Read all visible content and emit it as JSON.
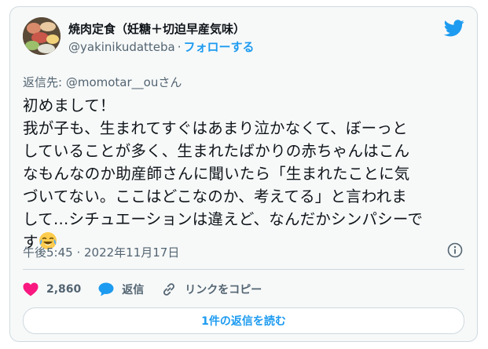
{
  "author": {
    "display_name": "焼肉定食（妊糖＋切迫早産気味）",
    "handle": "@yakinikudatteba",
    "separator": "·",
    "follow_label": "フォローする"
  },
  "reply_context": {
    "prefix": "返信先:",
    "mention": "@momotar__ouさん"
  },
  "tweet": {
    "lines": [
      "初めまして！",
      "我が子も、生まれてすぐはあまり泣かなくて、ぼーっと",
      "していることが多く、生まれたばかりの赤ちゃんはこん",
      "なもんなのか助産師さんに聞いたら「生まれたことに気",
      "づいてない。ここはどこなのか、考えてる」と言われま",
      "して…シチュエーションは違えど、なんだかシンパシーで",
      "す"
    ],
    "emoji": "face-with-tears-of-joy"
  },
  "meta": {
    "timestamp": "午後5:45 · 2022年11月17日"
  },
  "actions": {
    "like_count": "2,860",
    "reply_label": "返信",
    "copy_link_label": "リンクをコピー"
  },
  "footer": {
    "read_replies_label": "1件の返信を読む"
  },
  "icons": {
    "brand": "twitter-bird-icon",
    "info": "info-icon",
    "like": "heart-icon",
    "reply": "speech-bubble-icon",
    "copy": "link-icon"
  },
  "colors": {
    "accent": "#1d9bf0",
    "like": "#f91880",
    "text": "#0f1419",
    "muted": "#536471",
    "border": "#cfd9de",
    "card_bg": "#f7f9f9"
  }
}
